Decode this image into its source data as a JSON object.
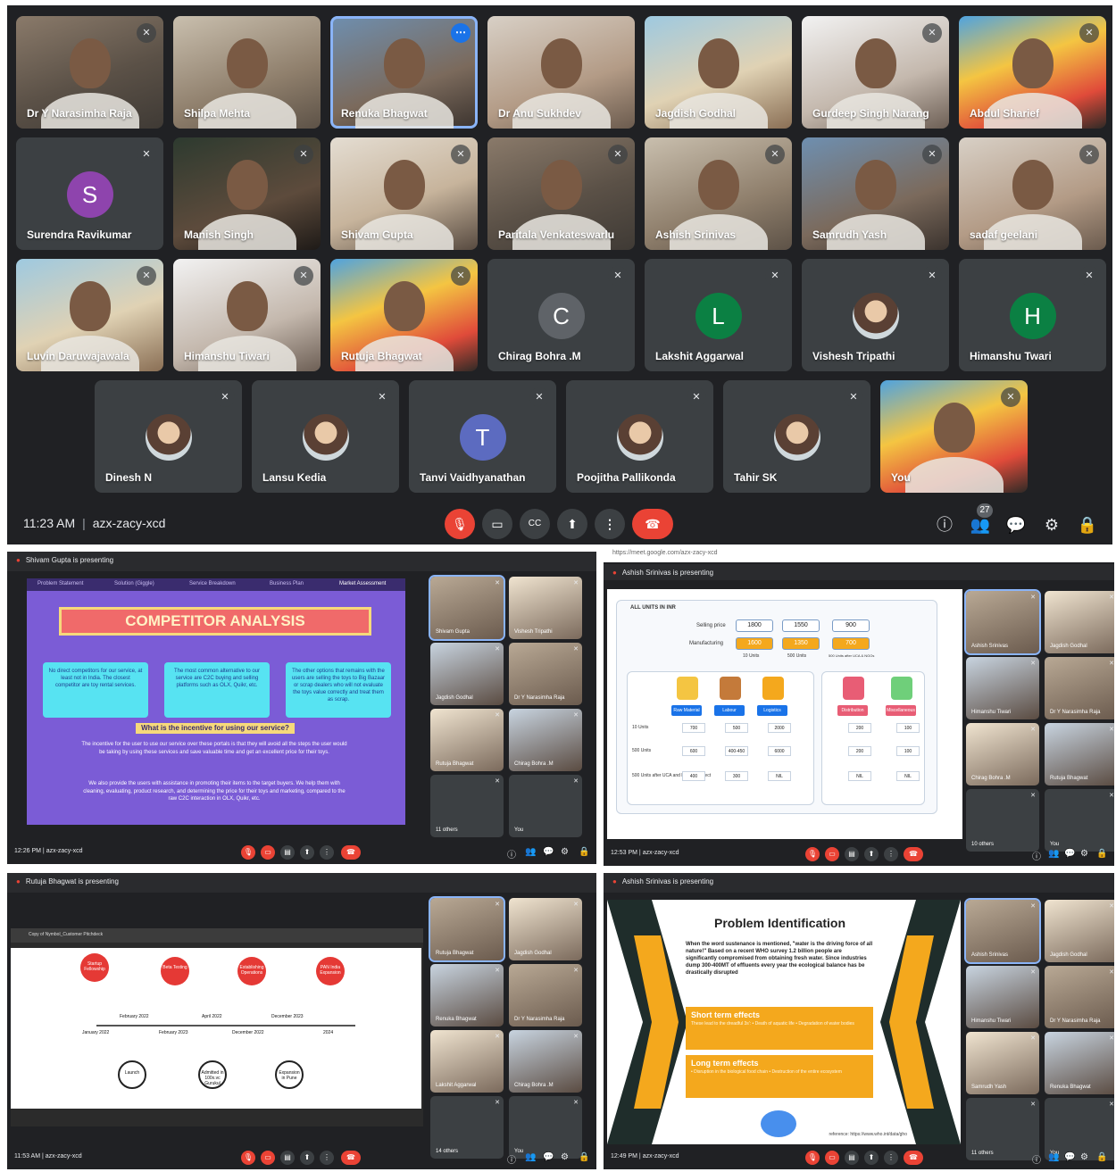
{
  "top_meeting": {
    "participants": [
      {
        "name": "Dr Y Narasimha Raja",
        "kind": "video",
        "muted": true
      },
      {
        "name": "Shilpa Mehta",
        "kind": "video",
        "muted": false
      },
      {
        "name": "Renuka Bhagwat",
        "kind": "video",
        "muted": false,
        "selected": true
      },
      {
        "name": "Dr Anu Sukhdev",
        "kind": "video",
        "muted": false
      },
      {
        "name": "Jagdish Godhal",
        "kind": "video",
        "muted": false
      },
      {
        "name": "Gurdeep Singh Narang",
        "kind": "video",
        "muted": true
      },
      {
        "name": "Abdul Sharief",
        "kind": "video",
        "muted": true
      },
      {
        "name": "Surendra Ravikumar",
        "kind": "avatar",
        "initial": "S",
        "color": "#8e44ad",
        "muted": true
      },
      {
        "name": "Manish Singh",
        "kind": "video",
        "muted": true
      },
      {
        "name": "Shivam Gupta",
        "kind": "video",
        "muted": true
      },
      {
        "name": "Paritala Venkateswarlu",
        "kind": "video",
        "muted": true
      },
      {
        "name": "Ashish Srinivas",
        "kind": "video",
        "muted": true
      },
      {
        "name": "Samrudh Yash",
        "kind": "video",
        "muted": true
      },
      {
        "name": "sadaf geelani",
        "kind": "video",
        "muted": true
      },
      {
        "name": "Luvin Daruwajawala",
        "kind": "video",
        "muted": true
      },
      {
        "name": "Himanshu Tiwari",
        "kind": "video",
        "muted": true
      },
      {
        "name": "Rutuja Bhagwat",
        "kind": "video",
        "muted": true
      },
      {
        "name": "Chirag Bohra .M",
        "kind": "avatar",
        "initial": "C",
        "color": "#5f6368",
        "muted": true
      },
      {
        "name": "Lakshit Aggarwal",
        "kind": "avatar",
        "initial": "L",
        "color": "#0b8043",
        "muted": true
      },
      {
        "name": "Vishesh Tripathi",
        "kind": "pic",
        "muted": true
      },
      {
        "name": "Himanshu Twari",
        "kind": "avatar",
        "initial": "H",
        "color": "#0b8043",
        "muted": true
      },
      {
        "name": "Dinesh N",
        "kind": "pic",
        "muted": true
      },
      {
        "name": "Lansu Kedia",
        "kind": "pic",
        "muted": true
      },
      {
        "name": "Tanvi Vaidhyanathan",
        "kind": "avatar",
        "initial": "T",
        "color": "#5c6bc0",
        "muted": true
      },
      {
        "name": "Poojitha Pallikonda",
        "kind": "pic",
        "muted": true
      },
      {
        "name": "Tahir SK",
        "kind": "pic",
        "muted": true
      },
      {
        "name": "You",
        "kind": "video",
        "muted": true
      }
    ],
    "time": "11:23 AM",
    "meeting_code": "azx-zacy-xcd",
    "participant_count": "27",
    "colors": {
      "bg": "#202124",
      "tile": "#3c4043",
      "end_call": "#ea4335",
      "accent": "#1a73e8"
    }
  },
  "shot_competitor": {
    "presenting": "Shivam Gupta is presenting",
    "tabs": [
      "Problem Statement",
      "Solution (Giggle)",
      "Service Breakdown",
      "Business Plan",
      "Market Assessment"
    ],
    "title": "COMPETITOR ANALYSIS",
    "cards": [
      "No direct competitors for our service, at least not in India. The closest competitor are toy rental services.",
      "The most common alternative to our service are C2C buying and selling platforms such as OLX, Quikr, etc.",
      "The other options that remains with the users are selling the toys to Big Bazaar or scrap dealers who will not evaluate the toys value correctly and treat them as scrap."
    ],
    "question": "What is the incentive for using our service?",
    "para1": "The incentive for the user to use our service over these portals is that they will avoid all the steps the user would be taking by using these services and save valuable time and get an excellent price for their toys.",
    "para2": "We also provide the users with assistance in promoting their items to the target buyers. We help them with cleaning, evaluating, product research, and determining the price for their toys and marketing, compared to the raw C2C interaction in OLX, Quikr, etc.",
    "side": [
      "Shivam Gupta",
      "Vishesh Tripathi",
      "Jagdish Godhal",
      "Dr Y Narasimha Raja",
      "Rutuja Bhagwat",
      "Chirag Bohra .M",
      "11 others",
      "You"
    ],
    "time": "12:26 PM",
    "code": "azx-zacy-xcd"
  },
  "shot_units": {
    "url": "https://meet.google.com/azx-zacy-xcd",
    "presenting": "Ashish Srinivas is presenting",
    "heading": "ALL UNITS IN INR",
    "selling_label": "Selling price",
    "manufacturing_label": "Manufacturing",
    "selling": [
      "1800",
      "1550",
      "900"
    ],
    "manufacturing": [
      "1600",
      "1350",
      "700"
    ],
    "unit_labels": [
      "10 Units",
      "500 Units",
      "500 Units after UCA & NGOs"
    ],
    "categories": [
      "Raw Material",
      "Labour",
      "Logistics",
      "Distribution",
      "Miscellaneous"
    ],
    "row_labels": [
      "10 Units",
      "500 Units",
      "500 Units after UCA and NGOs connect"
    ],
    "rows": [
      [
        "700",
        "500",
        "2000",
        "200",
        "100"
      ],
      [
        "600",
        "400-450",
        "6000",
        "200",
        "100"
      ],
      [
        "400",
        "300",
        "NIL",
        "NIL",
        "NIL"
      ]
    ],
    "side": [
      "Ashish Srinivas",
      "Jagdish Godhal",
      "Himanshu Tiwari",
      "Dr Y Narasimha Raja",
      "Chirag Bohra .M",
      "Rutuja Bhagwat",
      "10 others",
      "You"
    ],
    "time": "12:53 PM",
    "code": "azx-zacy-xcd"
  },
  "shot_timeline": {
    "presenting": "Rutuja Bhagwat is presenting",
    "doc_title": "Copy of Nymbol_Customer Pitchdeck",
    "nodes_top": [
      "Startup Fellowship",
      "Beta Testing",
      "Establishing Operations",
      "PAN India Expansion"
    ],
    "dates_top": [
      "February 2022",
      "April 2022",
      "December 2023"
    ],
    "dates_bottom": [
      "January 2022",
      "February 2023",
      "December 2022",
      "2024"
    ],
    "nodes_bottom": [
      "Launch",
      "Admitted in 100x.vc Gurukul",
      "Expansion in Pune"
    ],
    "side": [
      "Rutuja Bhagwat",
      "Jagdish Godhal",
      "Renuka Bhagwat",
      "Dr Y Narasimha Raja",
      "Lakshit Aggarwal",
      "Chirag Bohra .M",
      "14 others",
      "You"
    ],
    "time": "11:53 AM",
    "code": "azx-zacy-xcd"
  },
  "shot_problem": {
    "presenting": "Ashish Srinivas is presenting",
    "title": "Problem Identification",
    "body": "When the word sustenance is mentioned, \"water is the driving force of all nature!\" Based on a recent WHO survey 1.2 billion people are significantly compromised from obtaining fresh water. Since industries dump 300-400MT of effluents every year the ecological balance has be drastically disrupted",
    "short_h": "Short term effects",
    "short_t": "These lead to the dreadful 3s': • Death of aquatic life • Degradation of water bodies",
    "long_h": "Long term effects",
    "long_t": "• Disruption in the biological food chain • Destruction of the entire ecosystem",
    "reference": "reference: https://www.who.int/data/gho",
    "side": [
      "Ashish Srinivas",
      "Jagdish Godhal",
      "Himanshu Tiwari",
      "Dr Y Narasimha Raja",
      "Samrudh Yash",
      "Renuka Bhagwat",
      "11 others",
      "You"
    ],
    "time": "12:49 PM",
    "code": "azx-zacy-xcd"
  }
}
